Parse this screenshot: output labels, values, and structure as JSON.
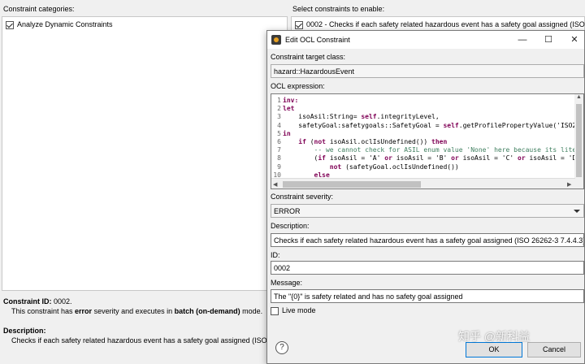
{
  "left": {
    "title": "Constraint categories:",
    "items": [
      {
        "label": "Analyze Dynamic Constraints",
        "checked": true
      }
    ],
    "constraint_id_label": "Constraint ID:",
    "constraint_id_value": "0002.",
    "severity_text_1": "This constraint has ",
    "severity_bold_1": "error",
    "severity_text_2": " severity and executes in ",
    "severity_bold_2": "batch (on-demand)",
    "severity_text_3": " mode.",
    "description_label": "Description:",
    "description_value": "Checks if each safety related hazardous event has a safety goal assigned (ISO"
  },
  "right": {
    "title": "Select constraints to enable:",
    "items": [
      {
        "label": "0002 - Checks if each safety related hazardous event has a safety goal assigned (ISO",
        "checked": true
      }
    ]
  },
  "dialog": {
    "title": "Edit OCL Constraint",
    "minimize": "—",
    "maximize": "☐",
    "close": "✕",
    "target_class_label": "Constraint target class:",
    "target_class_value": "hazard::HazardousEvent",
    "ocl_label": "OCL expression:",
    "code_lines": [
      {
        "num": "1",
        "parts": [
          {
            "t": "inv:",
            "c": "kw"
          }
        ]
      },
      {
        "num": "2",
        "parts": [
          {
            "t": "let",
            "c": "kw"
          }
        ]
      },
      {
        "num": "3",
        "parts": [
          {
            "t": "    isoAsil:String= ",
            "c": ""
          },
          {
            "t": "self",
            "c": "kw"
          },
          {
            "t": ".integrityLevel,",
            "c": ""
          }
        ]
      },
      {
        "num": "4",
        "parts": [
          {
            "t": "    safetyGoal:safetygoals::SafetyGoal = ",
            "c": ""
          },
          {
            "t": "self",
            "c": "kw"
          },
          {
            "t": ".getProfilePropertyValue('ISO2",
            "c": ""
          }
        ]
      },
      {
        "num": "5",
        "parts": [
          {
            "t": "in",
            "c": "kw"
          }
        ]
      },
      {
        "num": "6",
        "parts": [
          {
            "t": "    ",
            "c": ""
          },
          {
            "t": "if",
            "c": "kw"
          },
          {
            "t": " (",
            "c": ""
          },
          {
            "t": "not",
            "c": "kw"
          },
          {
            "t": " isoAsil.oclIsUndefined()) ",
            "c": ""
          },
          {
            "t": "then",
            "c": "kw"
          }
        ]
      },
      {
        "num": "7",
        "parts": [
          {
            "t": "        -- we cannot check for ASIL enum value 'None' here because its lite",
            "c": "cm"
          }
        ]
      },
      {
        "num": "8",
        "parts": [
          {
            "t": "        (",
            "c": ""
          },
          {
            "t": "if",
            "c": "kw"
          },
          {
            "t": " isoAsil = 'A' ",
            "c": ""
          },
          {
            "t": "or",
            "c": "kw"
          },
          {
            "t": " isoAsil = 'B' ",
            "c": ""
          },
          {
            "t": "or",
            "c": "kw"
          },
          {
            "t": " isoAsil = 'C' ",
            "c": ""
          },
          {
            "t": "or",
            "c": "kw"
          },
          {
            "t": " isoAsil = 'D",
            "c": ""
          }
        ]
      },
      {
        "num": "9",
        "parts": [
          {
            "t": "            ",
            "c": ""
          },
          {
            "t": "not",
            "c": "kw"
          },
          {
            "t": " (safetyGoal.oclIsUndefined())",
            "c": ""
          }
        ]
      },
      {
        "num": "10",
        "parts": [
          {
            "t": "        ",
            "c": ""
          },
          {
            "t": "else",
            "c": "kw"
          }
        ]
      }
    ],
    "severity_label": "Constraint severity:",
    "severity_value": "ERROR",
    "description_label": "Description:",
    "description_value": "Checks if each safety related hazardous event has a safety goal assigned (ISO 26262-3 7.4.4.3)",
    "id_label": "ID:",
    "id_value": "0002",
    "message_label": "Message:",
    "message_value": "The \"{0}\" is safety related and has no safety goal assigned",
    "live_mode_label": "Live mode",
    "live_mode_checked": false,
    "help": "?",
    "ok_label": "OK",
    "cancel_label": "Cancel"
  },
  "watermark": "知乎 @新科益"
}
